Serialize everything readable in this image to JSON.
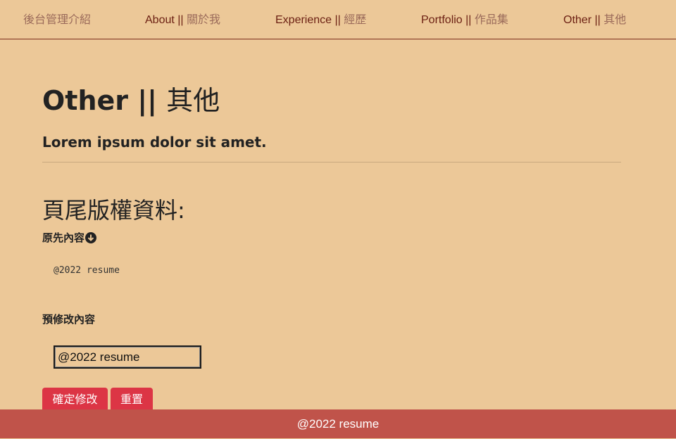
{
  "nav": {
    "brand": "後台管理介紹",
    "about": {
      "en": "About || ",
      "zh": "關於我"
    },
    "experience": {
      "en": "Experience || ",
      "zh": "經歷"
    },
    "portfolio": {
      "en": "Portfolio || ",
      "zh": "作品集"
    },
    "other": {
      "en": "Other || ",
      "zh": "其他"
    }
  },
  "page": {
    "title_en": "Other || ",
    "title_zh": "其他",
    "lead": "Lorem ipsum dolor sit amet.",
    "section_title": "頁尾版權資料:",
    "original_label": "原先內容",
    "original_value": "@2022 resume",
    "modify_label": "預修改內容",
    "modify_value": "@2022 resume",
    "confirm_label": "確定修改",
    "reset_label": "重置"
  },
  "icons": {
    "down": "arrow-down-circle-icon"
  },
  "colors": {
    "background": "#ecc898",
    "nav_text": "#6b1f12",
    "button": "#dc3545",
    "footer": "#c0534a"
  },
  "footer": {
    "text": "@2022 resume"
  }
}
